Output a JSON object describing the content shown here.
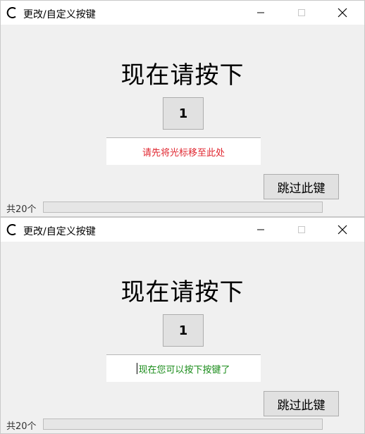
{
  "windows": [
    {
      "title": "更改/自定义按键",
      "heading": "现在请按下",
      "key": "1",
      "message": "请先将光标移至此处",
      "message_color": "#e0262f",
      "skip_label": "跳过此键",
      "count_label": "共20个",
      "progress": 0
    },
    {
      "title": "更改/自定义按键",
      "heading": "现在请按下",
      "key": "1",
      "message": "现在您可以按下按键了",
      "message_color": "#1a8c1a",
      "skip_label": "跳过此键",
      "count_label": "共20个",
      "progress": 0
    }
  ],
  "icons": {
    "app": "app-c-icon",
    "minimize": "minimize-icon",
    "maximize": "maximize-icon",
    "close": "close-icon"
  }
}
